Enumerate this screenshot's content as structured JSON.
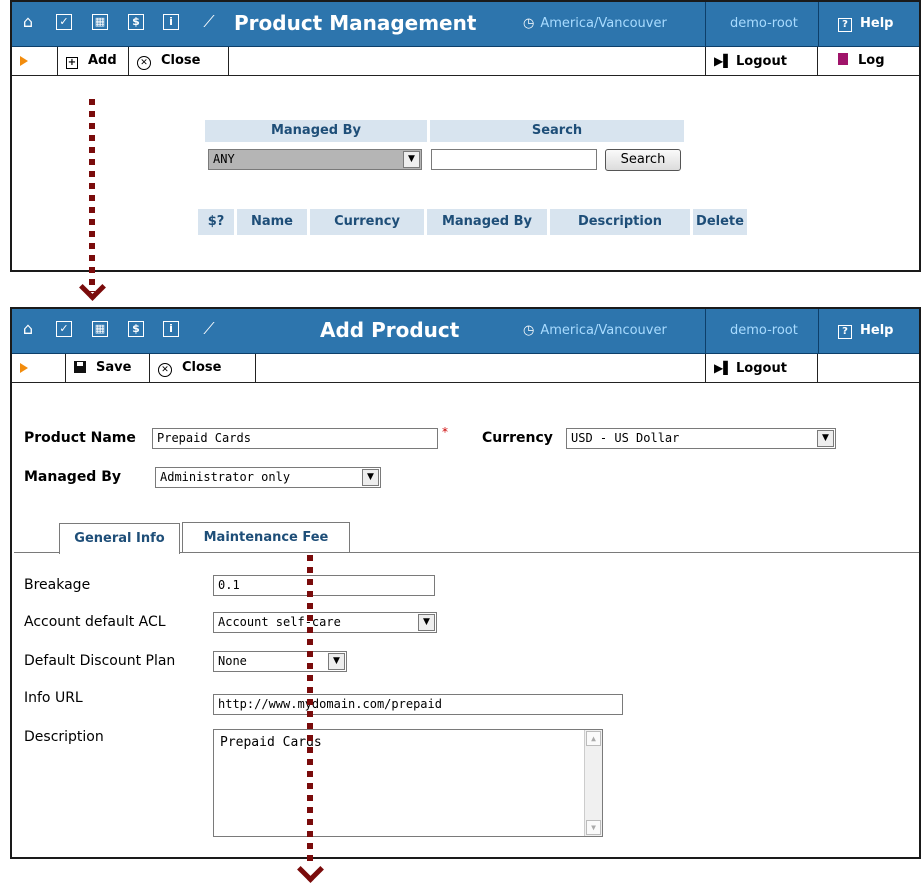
{
  "screen1": {
    "title": "Product Management",
    "timezone": "America/Vancouver",
    "user": "demo-root",
    "help": "Help",
    "toolbar": {
      "add": "Add",
      "close": "Close",
      "logout": "Logout",
      "log": "Log"
    },
    "filter": {
      "managed_by_header": "Managed By",
      "search_header": "Search",
      "managed_by_value": "ANY",
      "search_value": "",
      "search_button": "Search"
    },
    "columns": [
      "$?",
      "Name",
      "Currency",
      "Managed By",
      "Description",
      "Delete"
    ]
  },
  "screen2": {
    "title": "Add Product",
    "timezone": "America/Vancouver",
    "user": "demo-root",
    "help": "Help",
    "toolbar": {
      "save": "Save",
      "close": "Close",
      "logout": "Logout"
    },
    "form": {
      "product_name_label": "Product Name",
      "product_name_value": "Prepaid Cards",
      "required_mark": "*",
      "currency_label": "Currency",
      "currency_value": "USD - US Dollar",
      "managed_by_label": "Managed By",
      "managed_by_value": "Administrator only"
    },
    "tabs": [
      "General Info",
      "Maintenance Fee"
    ],
    "general": {
      "breakage_label": "Breakage",
      "breakage_value": "0.1",
      "acl_label": "Account default ACL",
      "acl_value": "Account self-care",
      "discount_label": "Default Discount Plan",
      "discount_value": "None",
      "info_url_label": "Info URL",
      "info_url_value": "http://www.mydomain.com/prepaid",
      "description_label": "Description",
      "description_value": "Prepaid Cards"
    }
  }
}
